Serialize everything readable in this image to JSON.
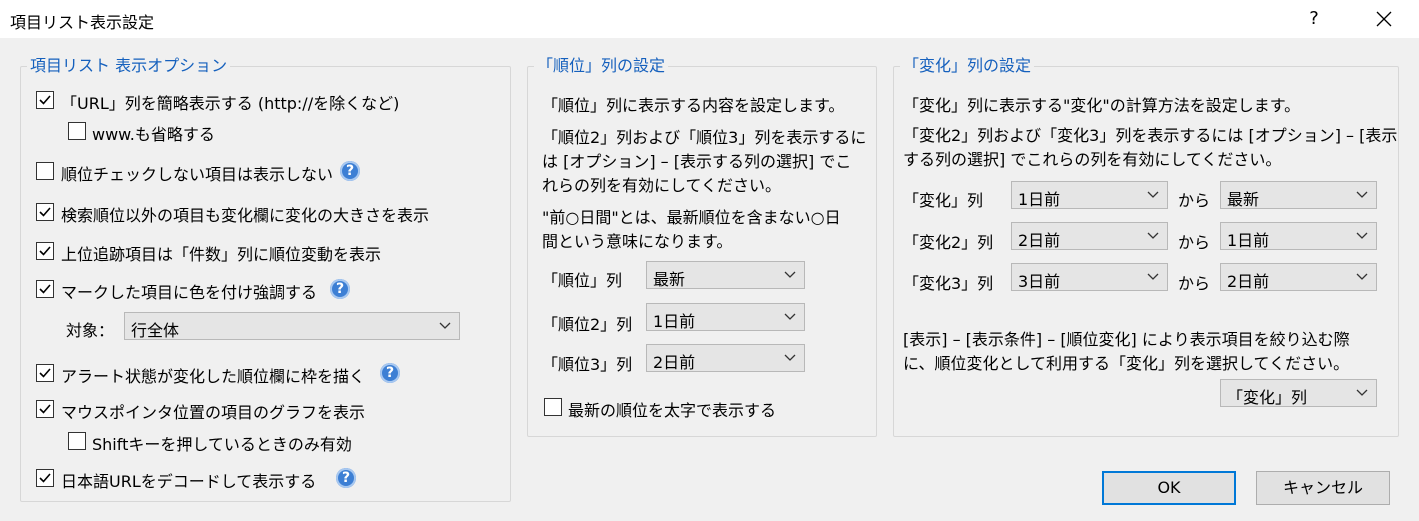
{
  "window": {
    "title": "項目リスト表示設定",
    "help": "?"
  },
  "left": {
    "title": "項目リスト 表示オプション",
    "opt_url_short": {
      "label": "「URL」列を簡略表示する (http://を除くなど)",
      "checked": true
    },
    "opt_www": {
      "label": "www.も省略する",
      "checked": false
    },
    "opt_hide_unchecked": {
      "label": "順位チェックしない項目は表示しない",
      "checked": false
    },
    "opt_change_size": {
      "label": "検索順位以外の項目も変化欄に変化の大きさを表示",
      "checked": true
    },
    "opt_upper_track": {
      "label": "上位追跡項目は「件数」列に順位変動を表示",
      "checked": true
    },
    "opt_mark_color": {
      "label": "マークした項目に色を付け強調する",
      "checked": true
    },
    "target_label": "対象：",
    "target_value": "行全体",
    "opt_alert_frame": {
      "label": "アラート状態が変化した順位欄に枠を描く",
      "checked": true
    },
    "opt_mouse_graph": {
      "label": "マウスポインタ位置の項目のグラフを表示",
      "checked": true
    },
    "opt_shift_only": {
      "label": "Shiftキーを押しているときのみ有効",
      "checked": false
    },
    "opt_decode_url": {
      "label": "日本語URLをデコードして表示する",
      "checked": true
    }
  },
  "middle": {
    "title": "「順位」列の設定",
    "desc1": "「順位」列に表示する内容を設定します。",
    "desc2_l1": "「順位2」列および「順位3」列を表示するに",
    "desc2_l2": "は [オプション] – [表示する列の選択] でこ",
    "desc2_l3": "れらの列を有効にしてください。",
    "desc3_l1": "\"前○日間\"とは、最新順位を含まない○日",
    "desc3_l2": "間という意味になります。",
    "rank1_label": "「順位」列",
    "rank1_value": "最新",
    "rank2_label": "「順位2」列",
    "rank2_value": "1日前",
    "rank3_label": "「順位3」列",
    "rank3_value": "2日前",
    "opt_bold_latest": {
      "label": "最新の順位を太字で表示する",
      "checked": false
    }
  },
  "right": {
    "title": "「変化」列の設定",
    "desc1": "「変化」列に表示する\"変化\"の計算方法を設定します。",
    "desc2_l1": "「変化2」列および「変化3」列を表示するには [オプション] – [表示",
    "desc2_l2": "する列の選択] でこれらの列を有効にしてください。",
    "from_word": "から",
    "change1": {
      "label": "「変化」列",
      "a": "1日前",
      "b": "最新"
    },
    "change2": {
      "label": "「変化2」列",
      "a": "2日前",
      "b": "1日前"
    },
    "change3": {
      "label": "「変化3」列",
      "a": "3日前",
      "b": "2日前"
    },
    "desc3_l1": "[表示] – [表示条件] – [順位変化] により表示項目を絞り込む際",
    "desc3_l2": "に、順位変化として利用する「変化」列を選択してください。",
    "filter_value": "「変化」列"
  },
  "buttons": {
    "ok": "OK",
    "cancel": "キャンセル"
  },
  "help_glyph": "?"
}
